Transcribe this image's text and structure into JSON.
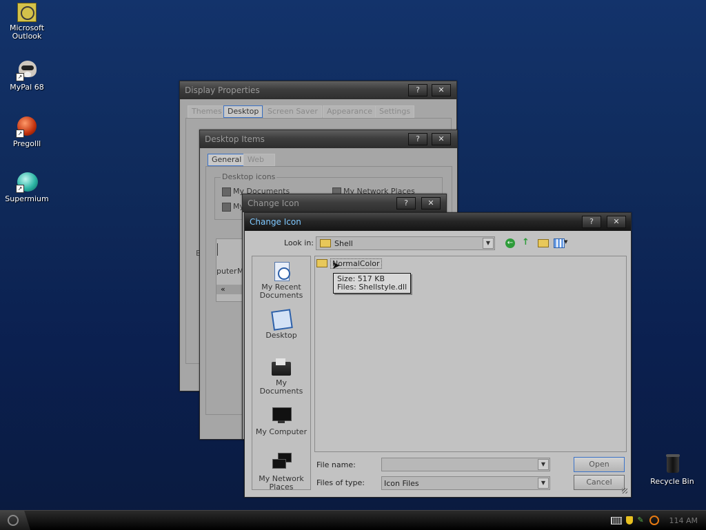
{
  "desktop": {
    "icons": [
      {
        "label_line1": "Microsoft",
        "label_line2": "Outlook"
      },
      {
        "label_line1": "MyPal 68"
      },
      {
        "label_line1": "Pregolll"
      },
      {
        "label_line1": "Supermium"
      },
      {
        "label_line1": "Recycle Bin"
      }
    ]
  },
  "display_properties": {
    "title": "Display Properties",
    "tabs": [
      "Themes",
      "Desktop",
      "Screen Saver",
      "Appearance",
      "Settings"
    ],
    "selected_tab": "Desktop"
  },
  "desktop_items": {
    "title": "Desktop Items",
    "tabs": [
      "General",
      "Web"
    ],
    "group_label": "Desktop icons",
    "checkboxes": [
      "My Documents",
      "My Network Places",
      "My"
    ],
    "partial_text": [
      "B",
      "puter",
      "M",
      "«"
    ]
  },
  "change_icon_back": {
    "title": "Change Icon"
  },
  "change_icon": {
    "title": "Change Icon",
    "look_in_label": "Look in:",
    "look_in_value": "Shell",
    "places": [
      {
        "line1": "My Recent",
        "line2": "Documents"
      },
      {
        "line1": "Desktop"
      },
      {
        "line1": "My",
        "line2": "Documents"
      },
      {
        "line1": "My Computer"
      },
      {
        "line1": "My Network",
        "line2": "Places"
      }
    ],
    "files": [
      {
        "name": "NormalColor"
      }
    ],
    "tooltip": {
      "line1": "Size: 517 KB",
      "line2": "Files: Shellstyle.dll"
    },
    "file_name_label": "File name:",
    "file_name_value": "",
    "files_of_type_label": "Files of type:",
    "files_of_type_value": "Icon Files",
    "open_label": "Open",
    "cancel_label": "Cancel",
    "help_glyph": "?",
    "close_glyph": "✕"
  },
  "taskbar": {
    "clock": "114 AM"
  }
}
